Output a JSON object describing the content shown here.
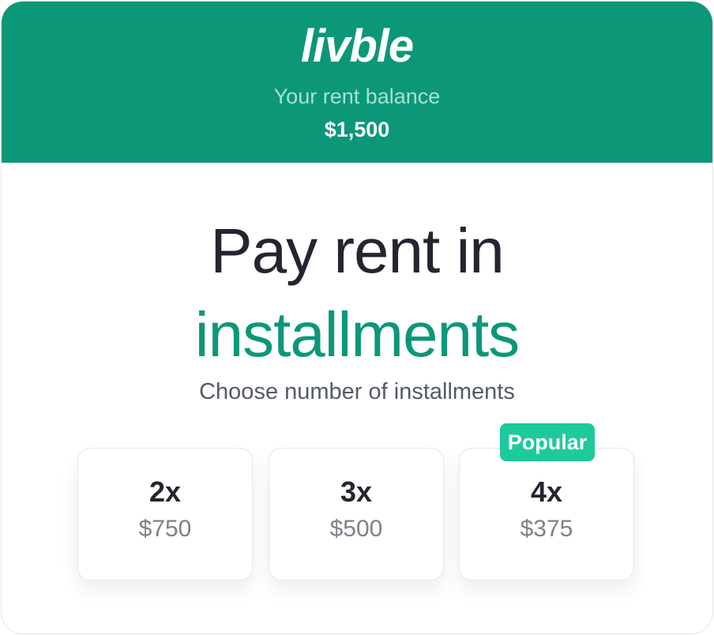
{
  "header": {
    "logo": "livble",
    "balance_label": "Your rent balance",
    "balance_value": "$1,500"
  },
  "title": {
    "line1": "Pay rent in",
    "line2": "installments"
  },
  "subtitle": "Choose number of installments",
  "options": [
    {
      "count": "2x",
      "amount": "$750"
    },
    {
      "count": "3x",
      "amount": "$500"
    },
    {
      "count": "4x",
      "amount": "$375",
      "badge": "Popular"
    }
  ],
  "colors": {
    "brand": "#0c9779",
    "badge": "#1ec99b",
    "text": "#23262f"
  }
}
